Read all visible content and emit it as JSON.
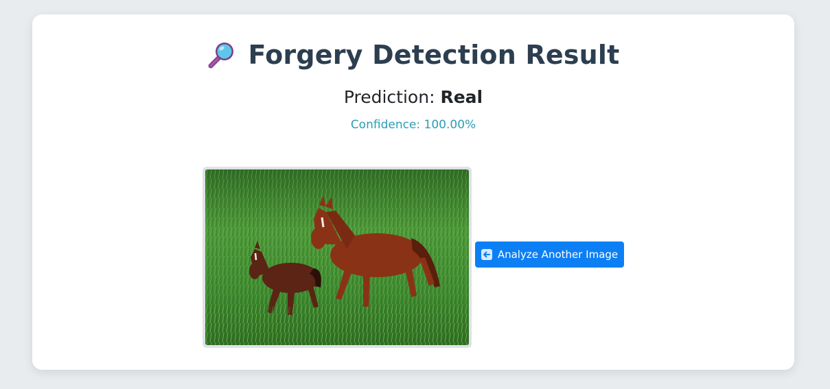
{
  "header": {
    "title": "Forgery Detection Result",
    "title_icon": "magnifier-icon"
  },
  "result": {
    "prediction_label": "Prediction:",
    "prediction_value": "Real",
    "confidence_text": "Confidence: 100.00%"
  },
  "image": {
    "subject": "mare-and-foal-running-in-grass"
  },
  "actions": {
    "analyze_label": "Analyze Another Image",
    "analyze_icon": "left-arrow-icon"
  },
  "colors": {
    "background": "#e9ecef",
    "card": "#ffffff",
    "title": "#2c3e50",
    "confidence": "#2a9db5",
    "button": "#0d7ff5"
  }
}
